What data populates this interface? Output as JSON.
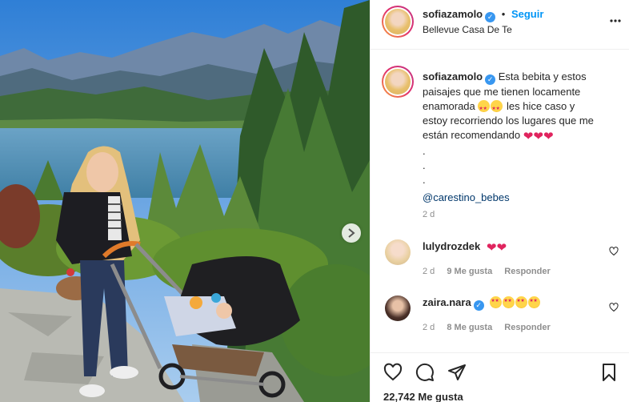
{
  "header": {
    "username": "sofiazamolo",
    "verified_mark": "✓",
    "follow_label": "Seguir",
    "dot": "•",
    "location": "Bellevue Casa De Te",
    "more_icon": "more-options-icon"
  },
  "caption": {
    "username": "sofiazamolo",
    "line1": "Esta bebita y estos",
    "line2": "paisajes que me tienen locamente",
    "line3a": "enamorada",
    "line3b": "les hice caso y",
    "line4": "estoy recorriendo los lugares que me",
    "line5": "están recomendando",
    "dot1": ".",
    "dot2": ".",
    "dot3": ".",
    "mention": "@carestino_bebes",
    "age": "2 d"
  },
  "comments": [
    {
      "username": "lulydrozdek",
      "age": "2 d",
      "likes": "9 Me gusta",
      "reply": "Responder"
    },
    {
      "username": "zaira.nara",
      "age": "2 d",
      "likes": "8 Me gusta",
      "reply": "Responder"
    }
  ],
  "actions": {
    "likes": "22,742 Me gusta"
  },
  "colors": {
    "accent": "#0095f6",
    "verified": "#3897f0",
    "heart": "#e0245e",
    "muted": "#8e8e8e"
  }
}
